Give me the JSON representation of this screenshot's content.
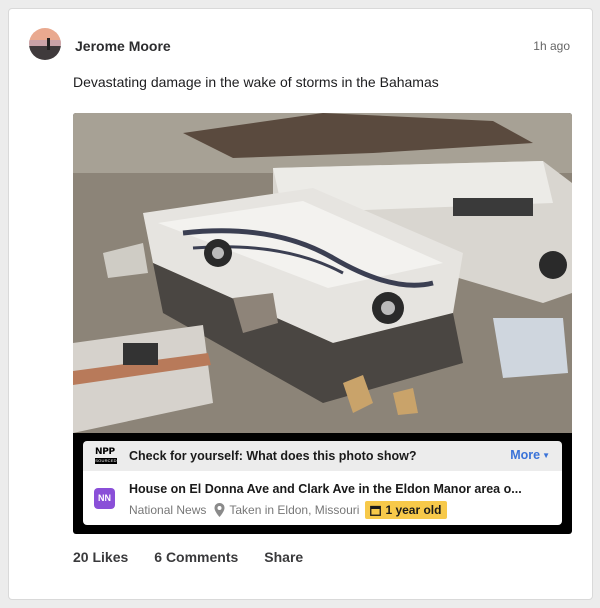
{
  "post": {
    "author": "Jerome Moore",
    "time": "1h ago",
    "caption": "Devastating damage in the wake of storms in the Bahamas"
  },
  "fact_check": {
    "logo_top": "NPP",
    "logo_bottom": "SOURCED",
    "question": "Check for yourself: What does this photo show?",
    "more_label": "More",
    "source_badge": "NN",
    "source_title": "House on El Donna Ave and Clark Ave in the Eldon Manor area o...",
    "source_name": "National News",
    "location": "Taken in Eldon, Missouri",
    "age": "1 year old"
  },
  "actions": {
    "likes": "20 Likes",
    "comments": "6 Comments",
    "share": "Share"
  },
  "colors": {
    "link": "#3a73d8",
    "age_badge": "#f7c94a",
    "source_badge": "#8a4fd8"
  }
}
